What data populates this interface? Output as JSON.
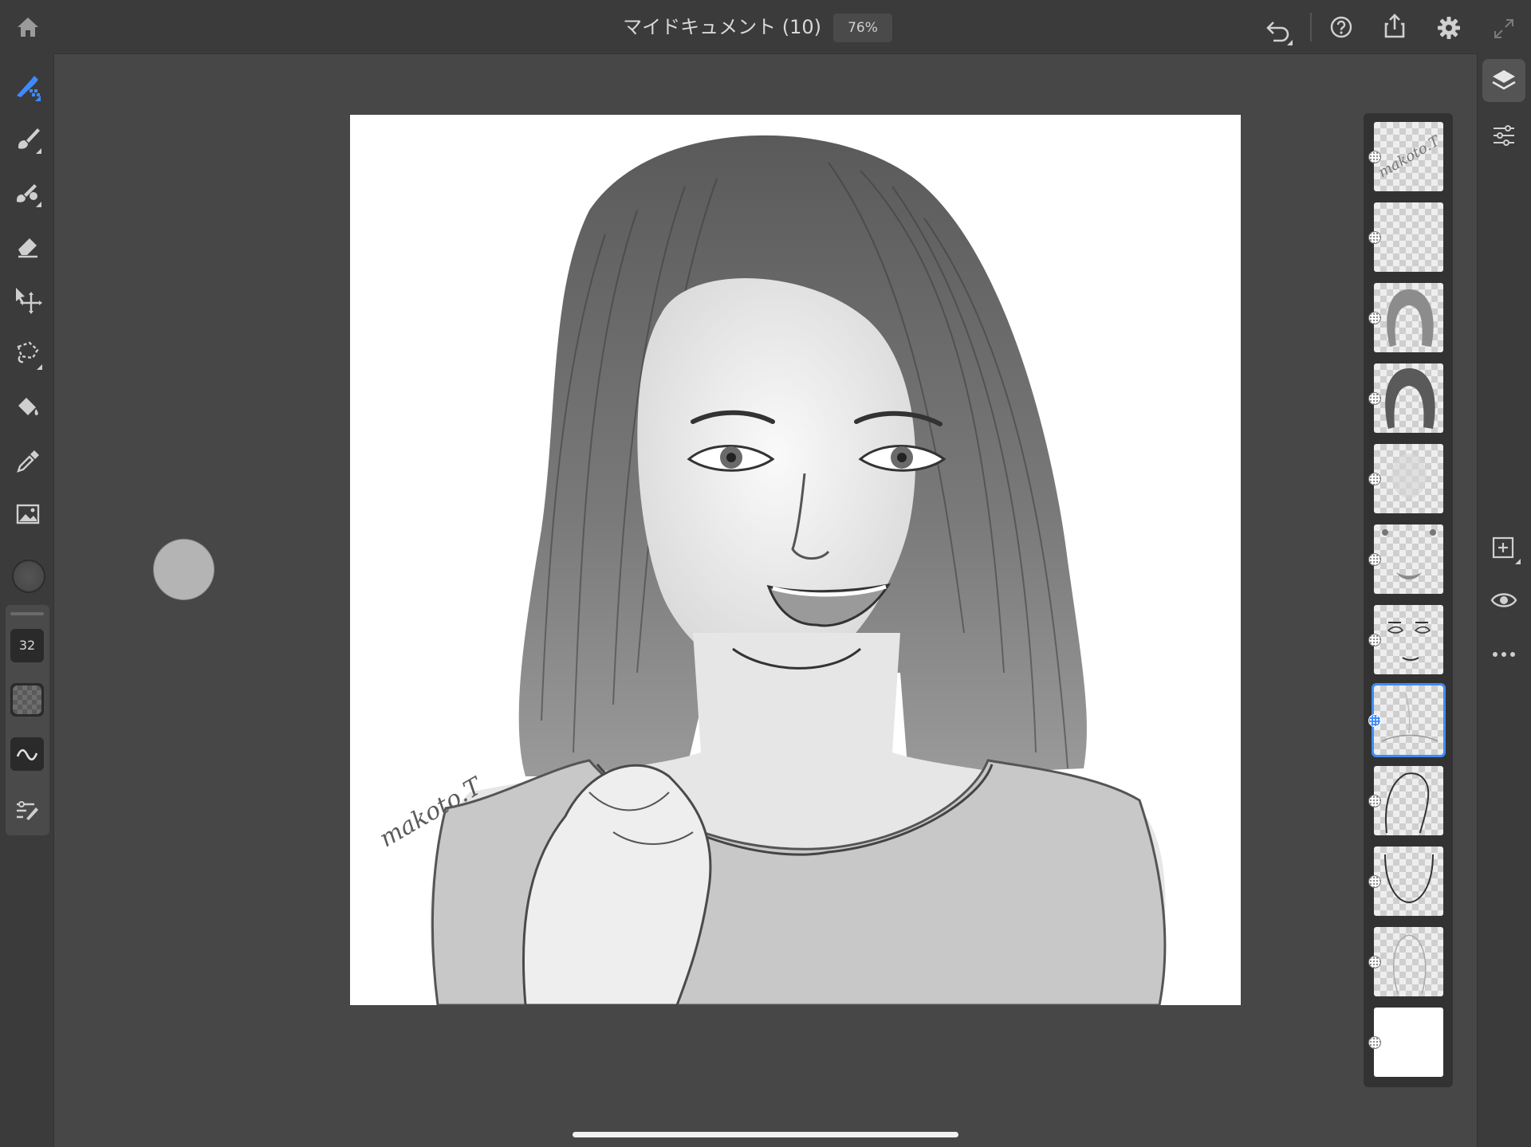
{
  "app": {
    "document_title": "マイドキュメント (10)",
    "zoom": "76%"
  },
  "topbar": {
    "icons": [
      "home-icon",
      "undo-icon",
      "help-icon",
      "share-icon",
      "settings-icon",
      "fullscreen-icon"
    ]
  },
  "tools": {
    "items": [
      "pixel-brush-icon",
      "live-brush-icon",
      "mixer-brush-icon",
      "eraser-icon",
      "transform-icon",
      "lasso-icon",
      "fill-icon",
      "eyedropper-icon",
      "place-image-icon"
    ],
    "brush_size": "32",
    "active_tool": "pixel-brush-icon"
  },
  "canvas": {
    "signature": "makoto.T",
    "description": "pencil portrait drawing"
  },
  "layers": {
    "count": 12,
    "selected_index": 7
  },
  "colors": {
    "accent": "#3d8bff",
    "ui_dark": "#3b3b3b",
    "workspace": "#474747"
  }
}
